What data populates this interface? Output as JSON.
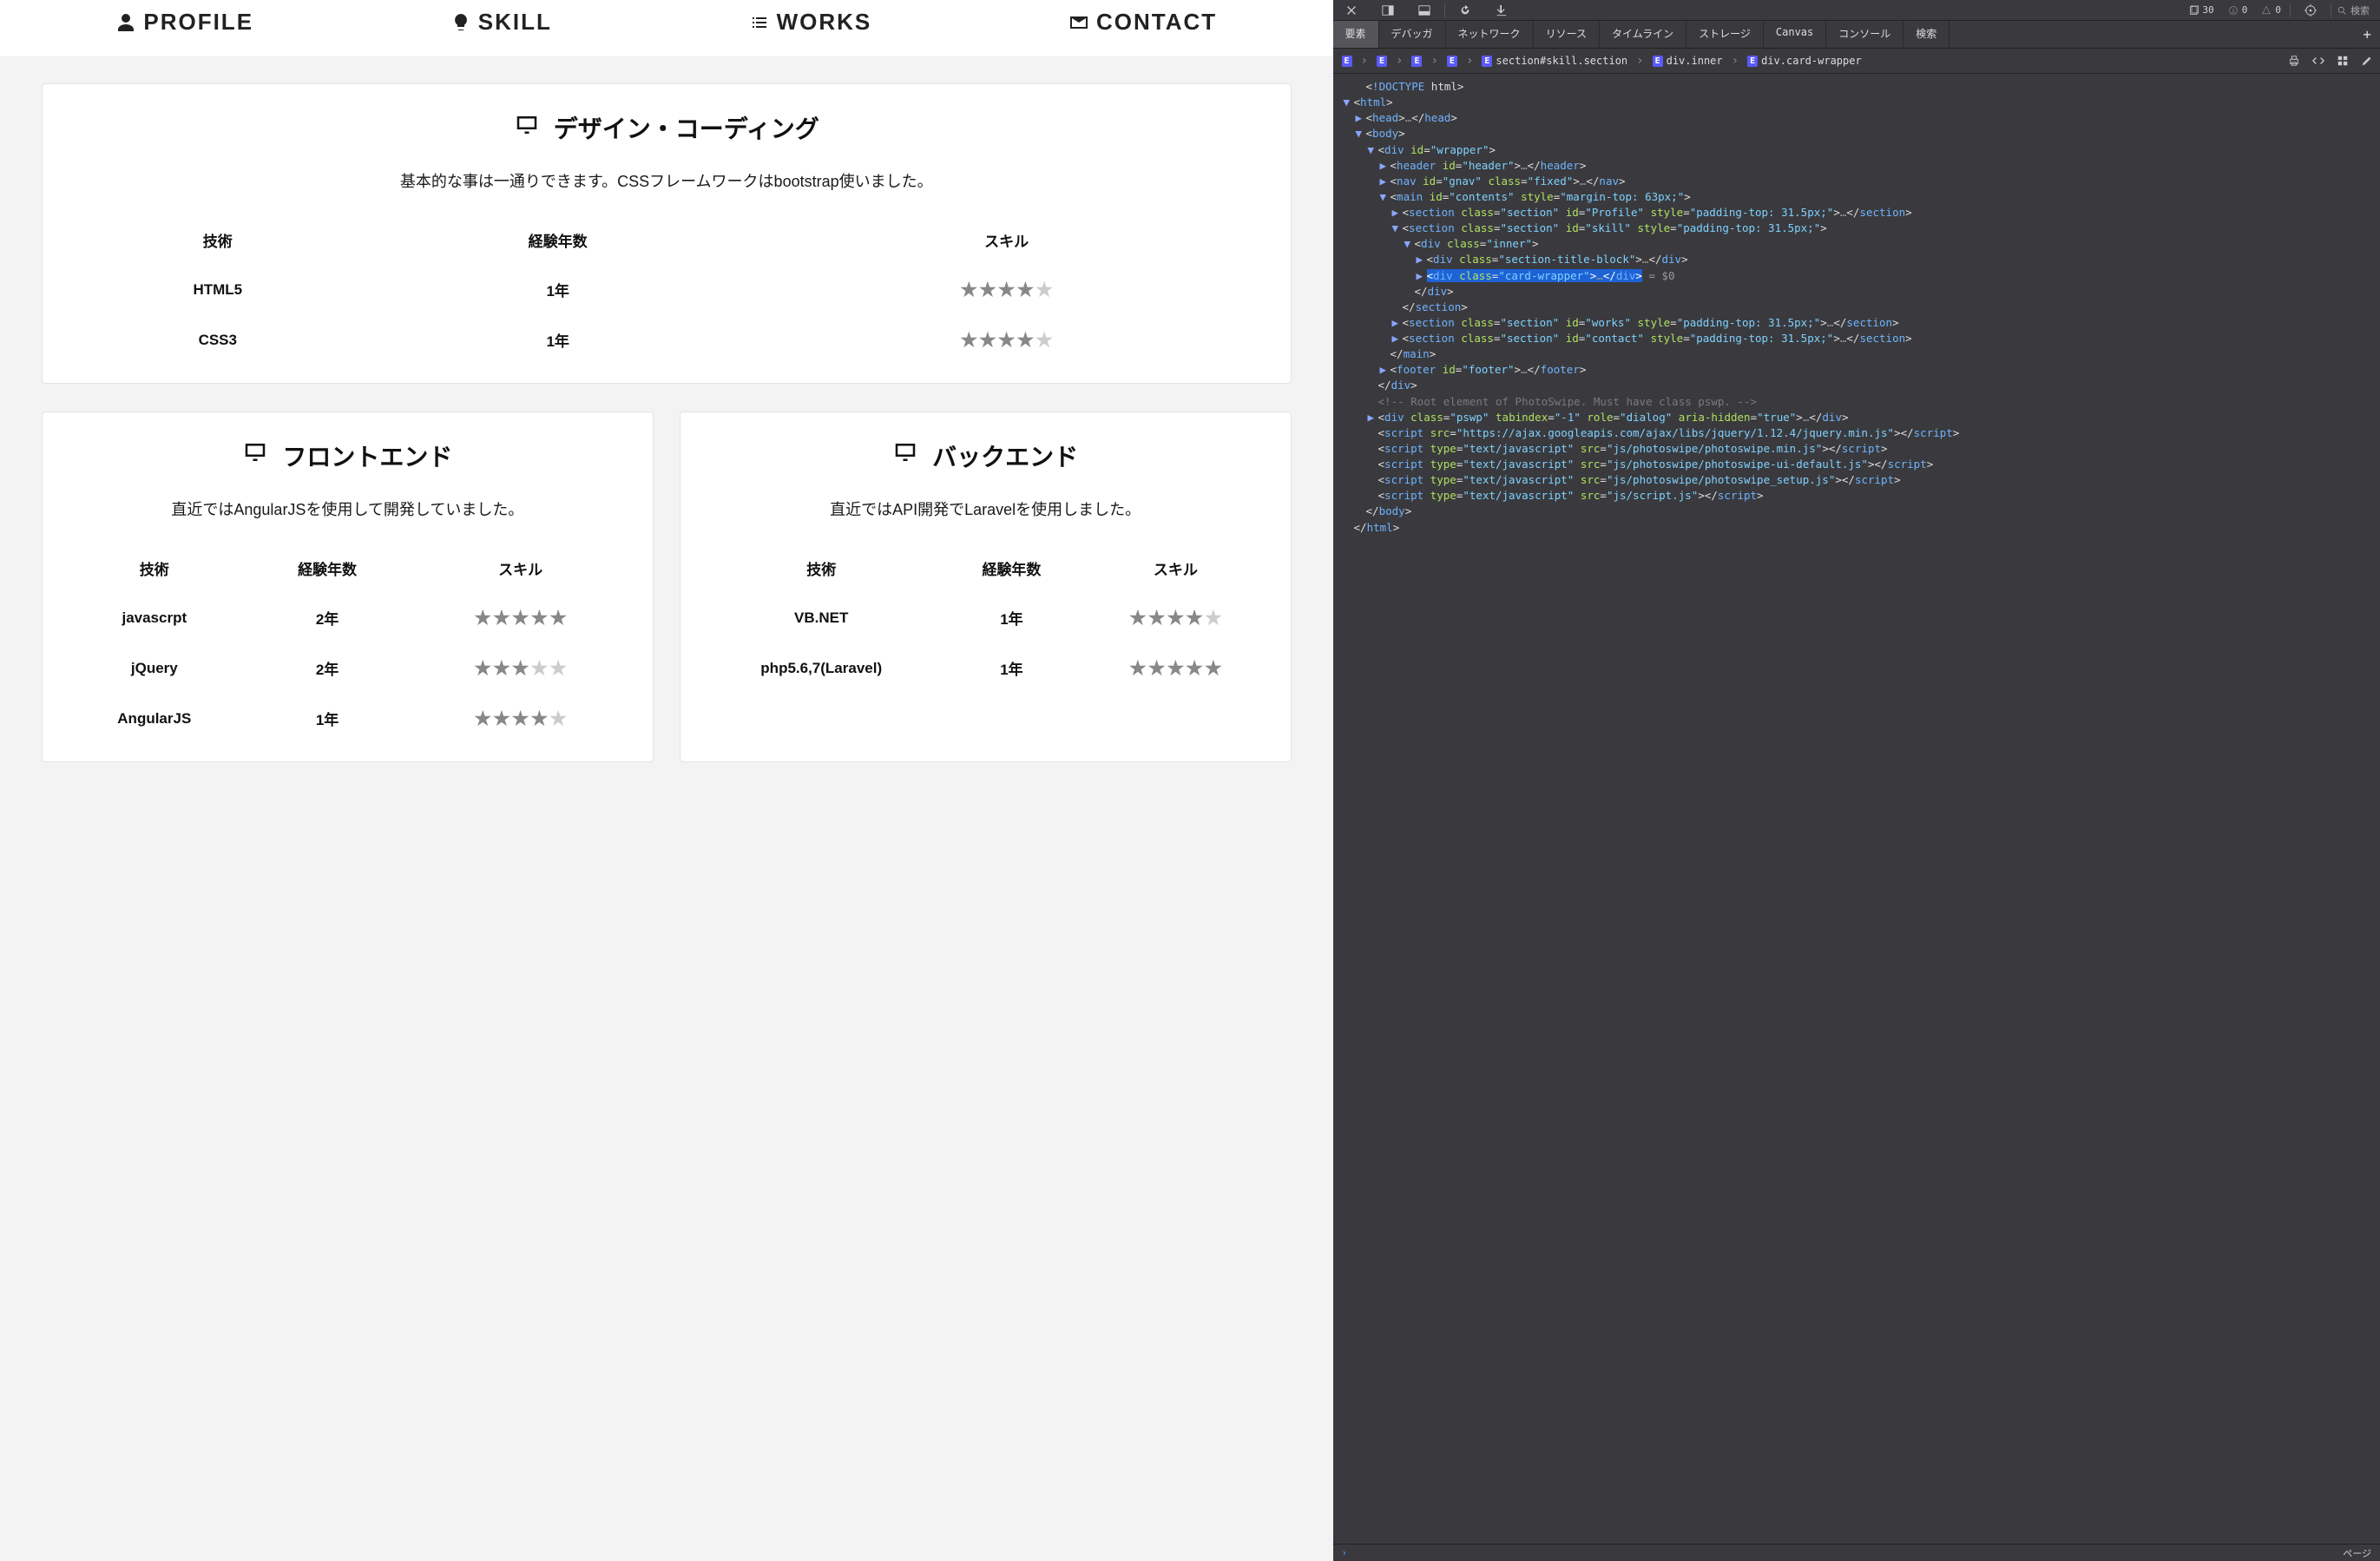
{
  "nav": {
    "profile": "PROFILE",
    "skill": "SKILL",
    "works": "WORKS",
    "contact": "CONTACT"
  },
  "cards": {
    "design": {
      "title": "デザイン・コーディング",
      "desc": "基本的な事は一通りできます。CSSフレームワークはbootstrap使いました。",
      "headers": {
        "tech": "技術",
        "years": "経験年数",
        "skill": "スキル"
      },
      "rows": [
        {
          "tech": "HTML5",
          "years": "1年",
          "stars": 4
        },
        {
          "tech": "CSS3",
          "years": "1年",
          "stars": 4
        }
      ]
    },
    "front": {
      "title": "フロントエンド",
      "desc": "直近ではAngularJSを使用して開発していました。",
      "headers": {
        "tech": "技術",
        "years": "経験年数",
        "skill": "スキル"
      },
      "rows": [
        {
          "tech": "javascrpt",
          "years": "2年",
          "stars": 5
        },
        {
          "tech": "jQuery",
          "years": "2年",
          "stars": 3
        },
        {
          "tech": "AngularJS",
          "years": "1年",
          "stars": 4
        }
      ]
    },
    "back": {
      "title": "バックエンド",
      "desc": "直近ではAPI開発でLaravelを使用しました。",
      "headers": {
        "tech": "技術",
        "years": "経験年数",
        "skill": "スキル"
      },
      "rows": [
        {
          "tech": "VB.NET",
          "years": "1年",
          "stars": 4
        },
        {
          "tech": "php5.6,7(Laravel)",
          "years": "1年",
          "stars": 5
        }
      ]
    }
  },
  "devtools": {
    "toolbar": {
      "badges": {
        "docs": "30",
        "info": "0",
        "warn": "0"
      },
      "search_placeholder": "検索"
    },
    "tabs": [
      "要素",
      "デバッガ",
      "ネットワーク",
      "リソース",
      "タイムライン",
      "ストレージ",
      "Canvas",
      "コンソール",
      "検索"
    ],
    "tabs_active": "要素",
    "crumbs": [
      {
        "tag": "E",
        "label": ""
      },
      {
        "tag": "E",
        "label": ""
      },
      {
        "tag": "E",
        "label": ""
      },
      {
        "tag": "E",
        "label": ""
      },
      {
        "tag": "E",
        "label": "section#skill.section"
      },
      {
        "tag": "E",
        "label": "div.inner"
      },
      {
        "tag": "E",
        "label": "div.card-wrapper"
      }
    ],
    "selected_suffix": " = $0",
    "src": [
      {
        "i": 1,
        "tw": "",
        "html": "<!DOCTYPE html>",
        "cls": "dim"
      },
      {
        "i": 0,
        "tw": "▼",
        "html": "<html>"
      },
      {
        "i": 1,
        "tw": "▶",
        "html": "<head>…</head>"
      },
      {
        "i": 1,
        "tw": "▼",
        "html": "<body>"
      },
      {
        "i": 2,
        "tw": "▼",
        "html": "<div id=\"wrapper\">"
      },
      {
        "i": 3,
        "tw": "▶",
        "html": "<header id=\"header\">…</header>"
      },
      {
        "i": 3,
        "tw": "▶",
        "html": "<nav id=\"gnav\" class=\"fixed\">…</nav>"
      },
      {
        "i": 3,
        "tw": "▼",
        "html": "<main id=\"contents\" style=\"margin-top: 63px;\">"
      },
      {
        "i": 4,
        "tw": "▶",
        "html": "<section class=\"section\" id=\"Profile\" style=\"padding-top: 31.5px;\">…</section>"
      },
      {
        "i": 4,
        "tw": "▼",
        "html": "<section class=\"section\" id=\"skill\" style=\"padding-top: 31.5px;\">"
      },
      {
        "i": 5,
        "tw": "▼",
        "html": "<div class=\"inner\">"
      },
      {
        "i": 6,
        "tw": "▶",
        "html": "<div class=\"section-title-block\">…</div>"
      },
      {
        "i": 6,
        "tw": "▶",
        "html": "<div class=\"card-wrapper\">…</div>",
        "sel": true
      },
      {
        "i": 5,
        "tw": "",
        "html": "</div>"
      },
      {
        "i": 4,
        "tw": "",
        "html": "</section>"
      },
      {
        "i": 4,
        "tw": "▶",
        "html": "<section class=\"section\" id=\"works\" style=\"padding-top: 31.5px;\">…</section>"
      },
      {
        "i": 4,
        "tw": "▶",
        "html": "<section class=\"section\" id=\"contact\" style=\"padding-top: 31.5px;\">…</section>"
      },
      {
        "i": 3,
        "tw": "",
        "html": "</main>"
      },
      {
        "i": 3,
        "tw": "▶",
        "html": "<footer id=\"footer\">…</footer>"
      },
      {
        "i": 2,
        "tw": "",
        "html": "</div>"
      },
      {
        "i": 2,
        "tw": "",
        "html": "<!-- Root element of PhotoSwipe. Must have class pswp. -->",
        "cls": "cmt"
      },
      {
        "i": 2,
        "tw": "▶",
        "html": "<div class=\"pswp\" tabindex=\"-1\" role=\"dialog\" aria-hidden=\"true\">…</div>"
      },
      {
        "i": 2,
        "tw": "",
        "html": "<script src=\"https://ajax.googleapis.com/ajax/libs/jquery/1.12.4/jquery.min.js\"></scr_ipt>"
      },
      {
        "i": 2,
        "tw": "",
        "html": "<script type=\"text/javascript\" src=\"js/photoswipe/photoswipe.min.js\"></scr_ipt>"
      },
      {
        "i": 2,
        "tw": "",
        "html": "<script type=\"text/javascript\" src=\"js/photoswipe/photoswipe-ui-default.js\"></scr_ipt>"
      },
      {
        "i": 2,
        "tw": "",
        "html": "<script type=\"text/javascript\" src=\"js/photoswipe/photoswipe_setup.js\"></scr_ipt>"
      },
      {
        "i": 2,
        "tw": "",
        "html": "<script type=\"text/javascript\" src=\"js/script.js\"></scr_ipt>"
      },
      {
        "i": 1,
        "tw": "",
        "html": "</body>"
      },
      {
        "i": 0,
        "tw": "",
        "html": "</html>"
      }
    ],
    "footer_right": "ページ"
  }
}
